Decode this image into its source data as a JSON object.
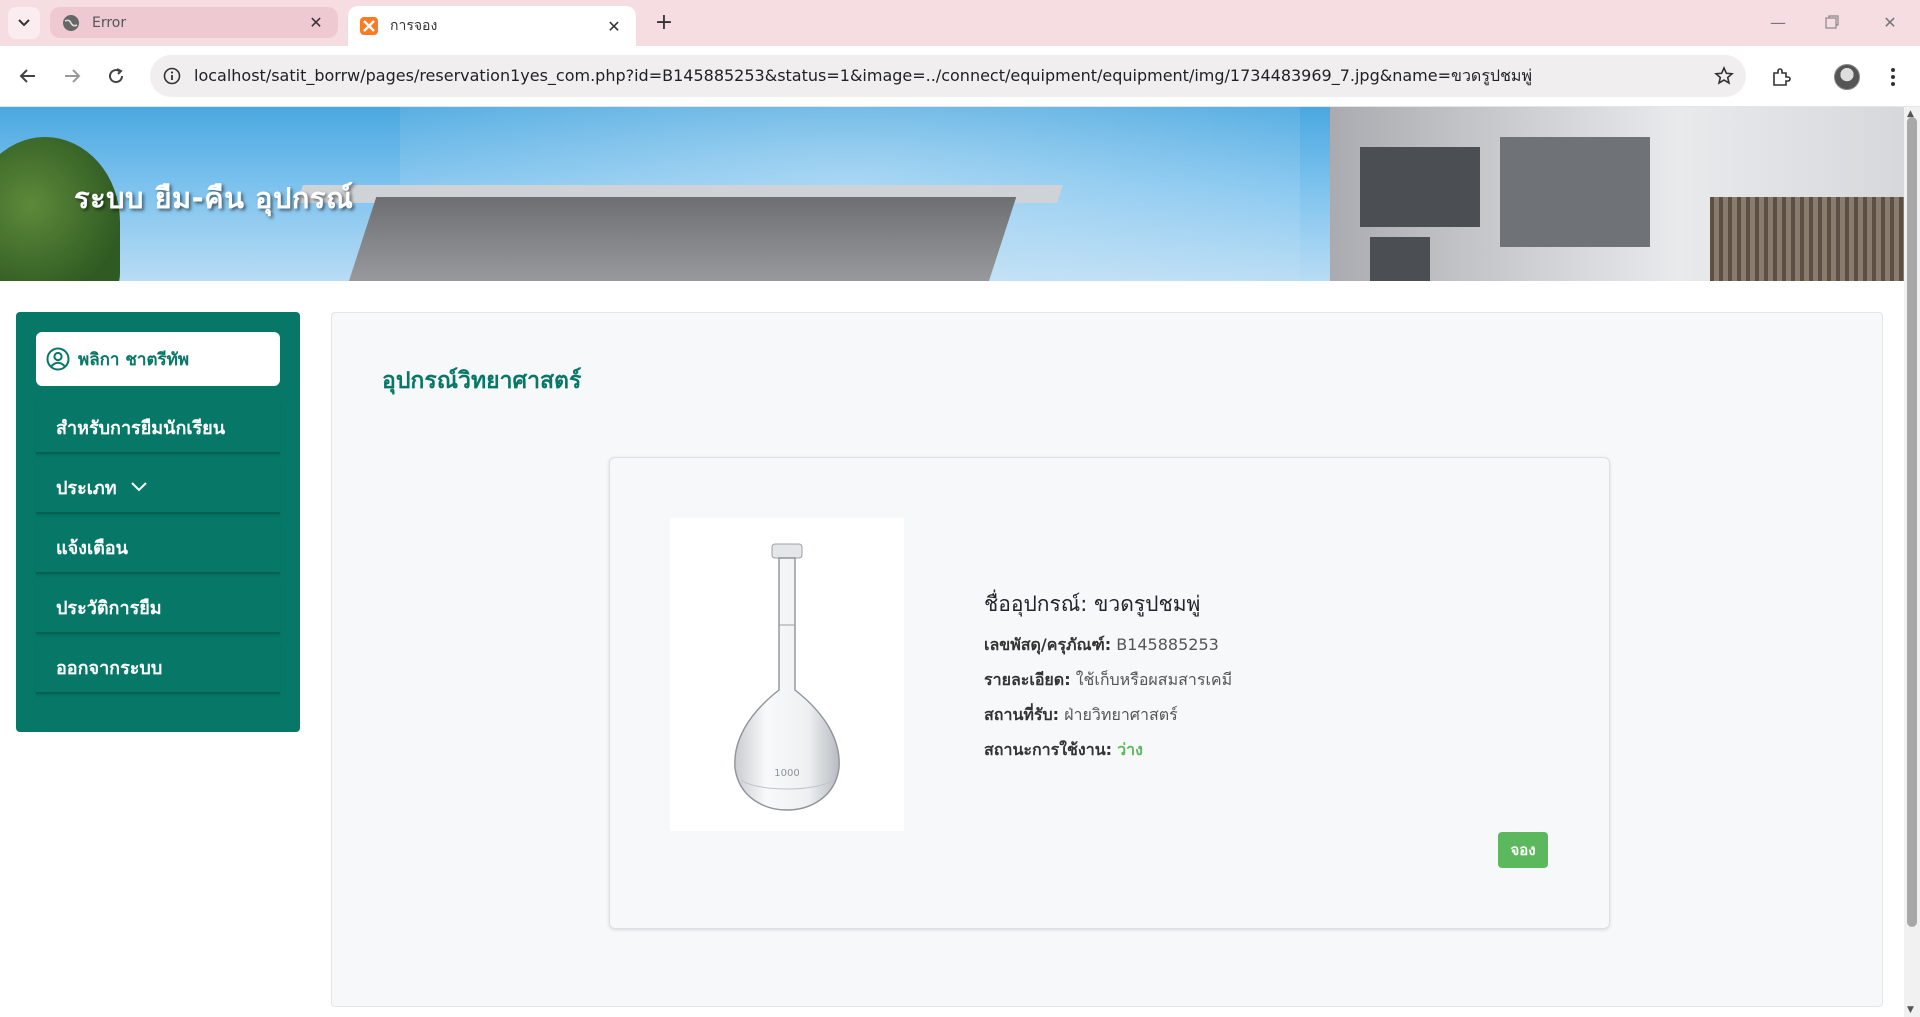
{
  "browser": {
    "tabs": [
      {
        "title": "Error",
        "icon": "globe-icon",
        "active": false
      },
      {
        "title": "การจอง",
        "icon": "xampp-icon",
        "active": true
      }
    ],
    "url": "localhost/satit_borrw/pages/reservation1yes_com.php?id=B145885253&status=1&image=../connect/equipment/equipment/img/1734483969_7.jpg&name=ขวดรูปชมพู่"
  },
  "banner": {
    "title": "ระบบ ยืม-คืน อุปกรณ์"
  },
  "sidebar": {
    "user_name": "พลิกา ชาตรีทัพ",
    "items": [
      {
        "label": "สำหรับการยืมนักเรียน"
      },
      {
        "label": "ประเภท",
        "has_dropdown": true
      },
      {
        "label": "แจ้งเตือน"
      },
      {
        "label": "ประวัติการยืม"
      },
      {
        "label": "ออกจากระบบ"
      }
    ],
    "color": "#077767"
  },
  "main": {
    "page_title": "อุปกรณ์วิทยาศาสตร์",
    "item": {
      "name_label": "ชื่ออุปกรณ์:",
      "name": "ขวดรูปชมพู่",
      "code_label": "เลขพัสดุ/ครุภัณฑ์:",
      "code": "B145885253",
      "detail_label": "รายละเอียด:",
      "detail": "ใช้เก็บหรือผสมสารเคมี",
      "location_label": "สถานที่รับ:",
      "location": "ฝ่ายวิทยาศาสตร์",
      "status_label": "สถานะการใช้งาน:",
      "status": "ว่าง",
      "status_color": "#5cb85c",
      "image_icon": "volumetric-flask-icon",
      "flask_marking": "1000"
    },
    "reserve_button": "จอง"
  }
}
